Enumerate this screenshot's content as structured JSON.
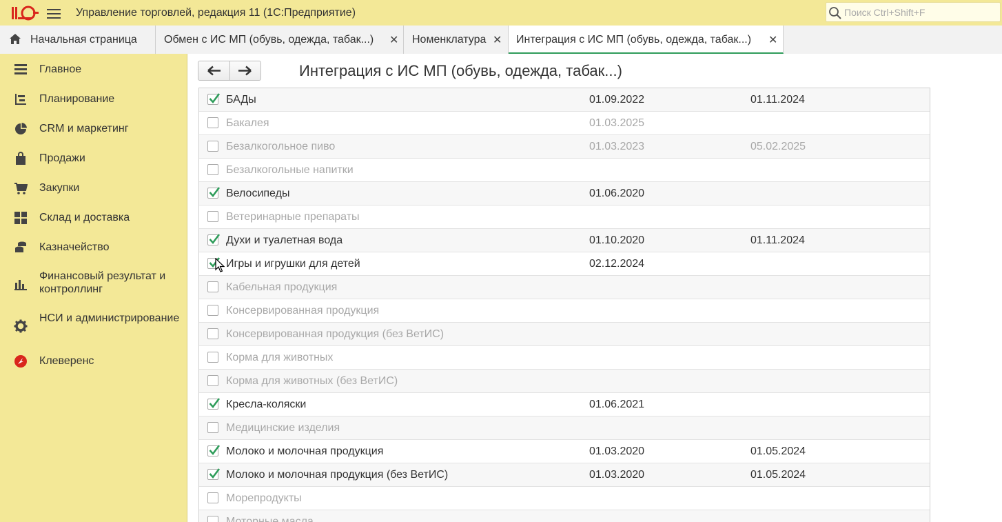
{
  "window": {
    "title": "Управление торговлей, редакция 11  (1С:Предприятие)",
    "search_placeholder": "Поиск Ctrl+Shift+F"
  },
  "colors": {
    "panel": "#f3e897",
    "accent_check": "#2e9c5a",
    "active_tab_underline": "#2e9c5a"
  },
  "tabs": [
    {
      "label": "Начальная страница",
      "icon": "home-icon",
      "closable": false
    },
    {
      "label": "Обмен с ИС МП (обувь, одежда, табак...)",
      "closable": true
    },
    {
      "label": "Номенклатура",
      "closable": true
    },
    {
      "label": "Интеграция с ИС МП (обувь, одежда, табак...)",
      "closable": true,
      "active": true
    }
  ],
  "sidebar": {
    "items": [
      {
        "label": "Главное",
        "icon": "menu-lines-icon"
      },
      {
        "label": "Планирование",
        "icon": "planning-icon"
      },
      {
        "label": "CRM и маркетинг",
        "icon": "pie-chart-icon"
      },
      {
        "label": "Продажи",
        "icon": "shopping-bag-icon"
      },
      {
        "label": "Закупки",
        "icon": "cart-icon"
      },
      {
        "label": "Склад и доставка",
        "icon": "warehouse-grid-icon"
      },
      {
        "label": "Казначейство",
        "icon": "coins-icon"
      },
      {
        "label": "Финансовый результат и контроллинг",
        "icon": "bar-chart-icon"
      },
      {
        "label": "НСИ и администрирование",
        "icon": "gear-icon"
      },
      {
        "label": "Клеверенс",
        "icon": "cleverence-icon"
      }
    ]
  },
  "main": {
    "title": "Интеграция с ИС МП (обувь, одежда, табак...)",
    "nav": {
      "back": "back-arrow-icon",
      "forward": "forward-arrow-icon"
    },
    "rows": [
      {
        "name": "БАДы",
        "checked": true,
        "date1": "01.09.2022",
        "date2": "01.11.2024"
      },
      {
        "name": "Бакалея",
        "checked": false,
        "date1": "01.03.2025",
        "date2": ""
      },
      {
        "name": "Безалкогольное пиво",
        "checked": false,
        "date1": "01.03.2023",
        "date2": "05.02.2025"
      },
      {
        "name": "Безалкогольные напитки",
        "checked": false,
        "date1": "",
        "date2": ""
      },
      {
        "name": "Велосипеды",
        "checked": true,
        "date1": "01.06.2020",
        "date2": ""
      },
      {
        "name": "Ветеринарные препараты",
        "checked": false,
        "date1": "",
        "date2": ""
      },
      {
        "name": "Духи и туалетная вода",
        "checked": true,
        "date1": "01.10.2020",
        "date2": "01.11.2024"
      },
      {
        "name": "Игры и игрушки для детей",
        "checked": true,
        "date1": "02.12.2024",
        "date2": ""
      },
      {
        "name": "Кабельная продукция",
        "checked": false,
        "date1": "",
        "date2": ""
      },
      {
        "name": "Консервированная продукция",
        "checked": false,
        "date1": "",
        "date2": ""
      },
      {
        "name": "Консервированная продукция (без ВетИС)",
        "checked": false,
        "date1": "",
        "date2": ""
      },
      {
        "name": "Корма для животных",
        "checked": false,
        "date1": "",
        "date2": ""
      },
      {
        "name": "Корма для животных (без ВетИС)",
        "checked": false,
        "date1": "",
        "date2": ""
      },
      {
        "name": "Кресла-коляски",
        "checked": true,
        "date1": "01.06.2021",
        "date2": ""
      },
      {
        "name": "Медицинские изделия",
        "checked": false,
        "date1": "",
        "date2": ""
      },
      {
        "name": "Молоко и молочная продукция",
        "checked": true,
        "date1": "01.03.2020",
        "date2": "01.05.2024"
      },
      {
        "name": "Молоко и молочная продукция (без ВетИС)",
        "checked": true,
        "date1": "01.03.2020",
        "date2": "01.05.2024"
      },
      {
        "name": "Морепродукты",
        "checked": false,
        "date1": "",
        "date2": ""
      },
      {
        "name": "Моторные масла",
        "checked": false,
        "date1": "",
        "date2": ""
      }
    ]
  }
}
